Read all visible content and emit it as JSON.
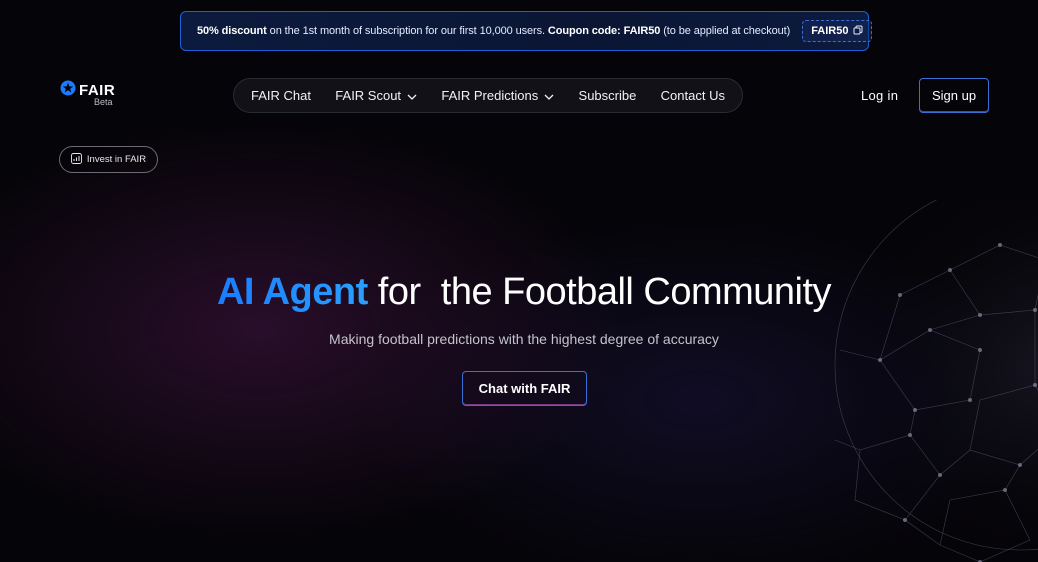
{
  "promo": {
    "bold_lead": "50% discount",
    "text_mid": " on the 1st month of subscription for our first 10,000 users. ",
    "bold_code_label": "Coupon code: FAIR50",
    "text_tail": " (to be applied at checkout)",
    "coupon_code": "FAIR50",
    "copy_icon": "copy-icon"
  },
  "brand": {
    "name": "FAIR",
    "tag": "Beta",
    "icon": "star-badge-icon"
  },
  "nav": {
    "items": [
      {
        "label": "FAIR Chat",
        "has_dropdown": false
      },
      {
        "label": "FAIR Scout",
        "has_dropdown": true
      },
      {
        "label": "FAIR Predictions",
        "has_dropdown": true
      },
      {
        "label": "Subscribe",
        "has_dropdown": false
      },
      {
        "label": "Contact Us",
        "has_dropdown": false
      }
    ]
  },
  "auth": {
    "login": "Log in",
    "signup": "Sign up"
  },
  "invest": {
    "label": "Invest in FAIR",
    "icon": "chart-icon"
  },
  "hero": {
    "accent": "AI Agent",
    "title_rest": " for  the Football Community",
    "subtitle": "Making football predictions with the highest degree of accuracy",
    "cta": "Chat with FAIR"
  },
  "colors": {
    "accent_blue": "#1f8fff",
    "border_blue": "#3b6fd8",
    "background": "#050408"
  }
}
